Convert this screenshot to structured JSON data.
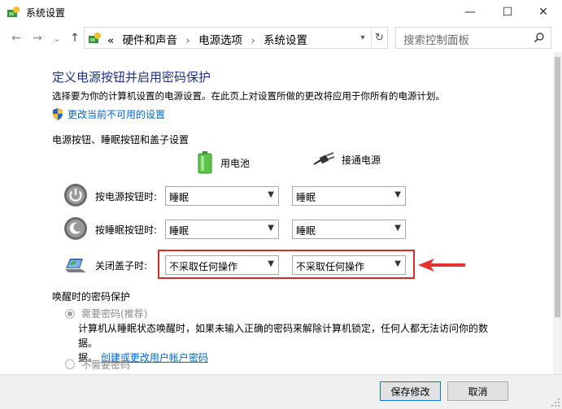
{
  "window": {
    "title": "系统设置",
    "minimize": "—",
    "maximize": "☐",
    "close": "✕"
  },
  "nav": {
    "back": "←",
    "forward": "→",
    "recent": "⌄",
    "up": "↑",
    "breadcrumb_lead": "«",
    "breadcrumb": [
      "硬件和声音",
      "电源选项",
      "系统设置"
    ],
    "separator": "›",
    "search_placeholder": "搜索控制面板"
  },
  "main": {
    "title": "定义电源按钮并启用密码保护",
    "description": "选择要为你的计算机设置的电源设置。在此页上对设置所做的更改将应用于你所有的电源计划。",
    "change_unavailable_link": "更改当前不可用的设置",
    "power_section_heading": "电源按钮、睡眠按钮和盖子设置",
    "column_battery": "用电池",
    "column_plugged": "接通电源",
    "rows": [
      {
        "label": "按电源按钮时:",
        "battery": "睡眠",
        "plugged": "睡眠"
      },
      {
        "label": "按睡眠按钮时:",
        "battery": "睡眠",
        "plugged": "睡眠"
      },
      {
        "label": "关闭盖子时:",
        "battery": "不采取任何操作",
        "plugged": "不采取任何操作"
      }
    ],
    "password_section_heading": "唤醒时的密码保护",
    "option_require": "需要密码(推荐)",
    "option_require_desc": "计算机从睡眠状态唤醒时，如果未输入正确的密码来解除计算机锁定，任何人都无法访问你的数据。",
    "option_require_desc_tail": "据。",
    "account_password_link": "创建或更改用户帐户密码",
    "option_no_require": "不需要密码"
  },
  "footer": {
    "save": "保存修改",
    "cancel": "取消"
  },
  "colors": {
    "title_blue": "#1e3287",
    "link_blue": "#0066cc",
    "highlight_red": "#d62b2b"
  }
}
